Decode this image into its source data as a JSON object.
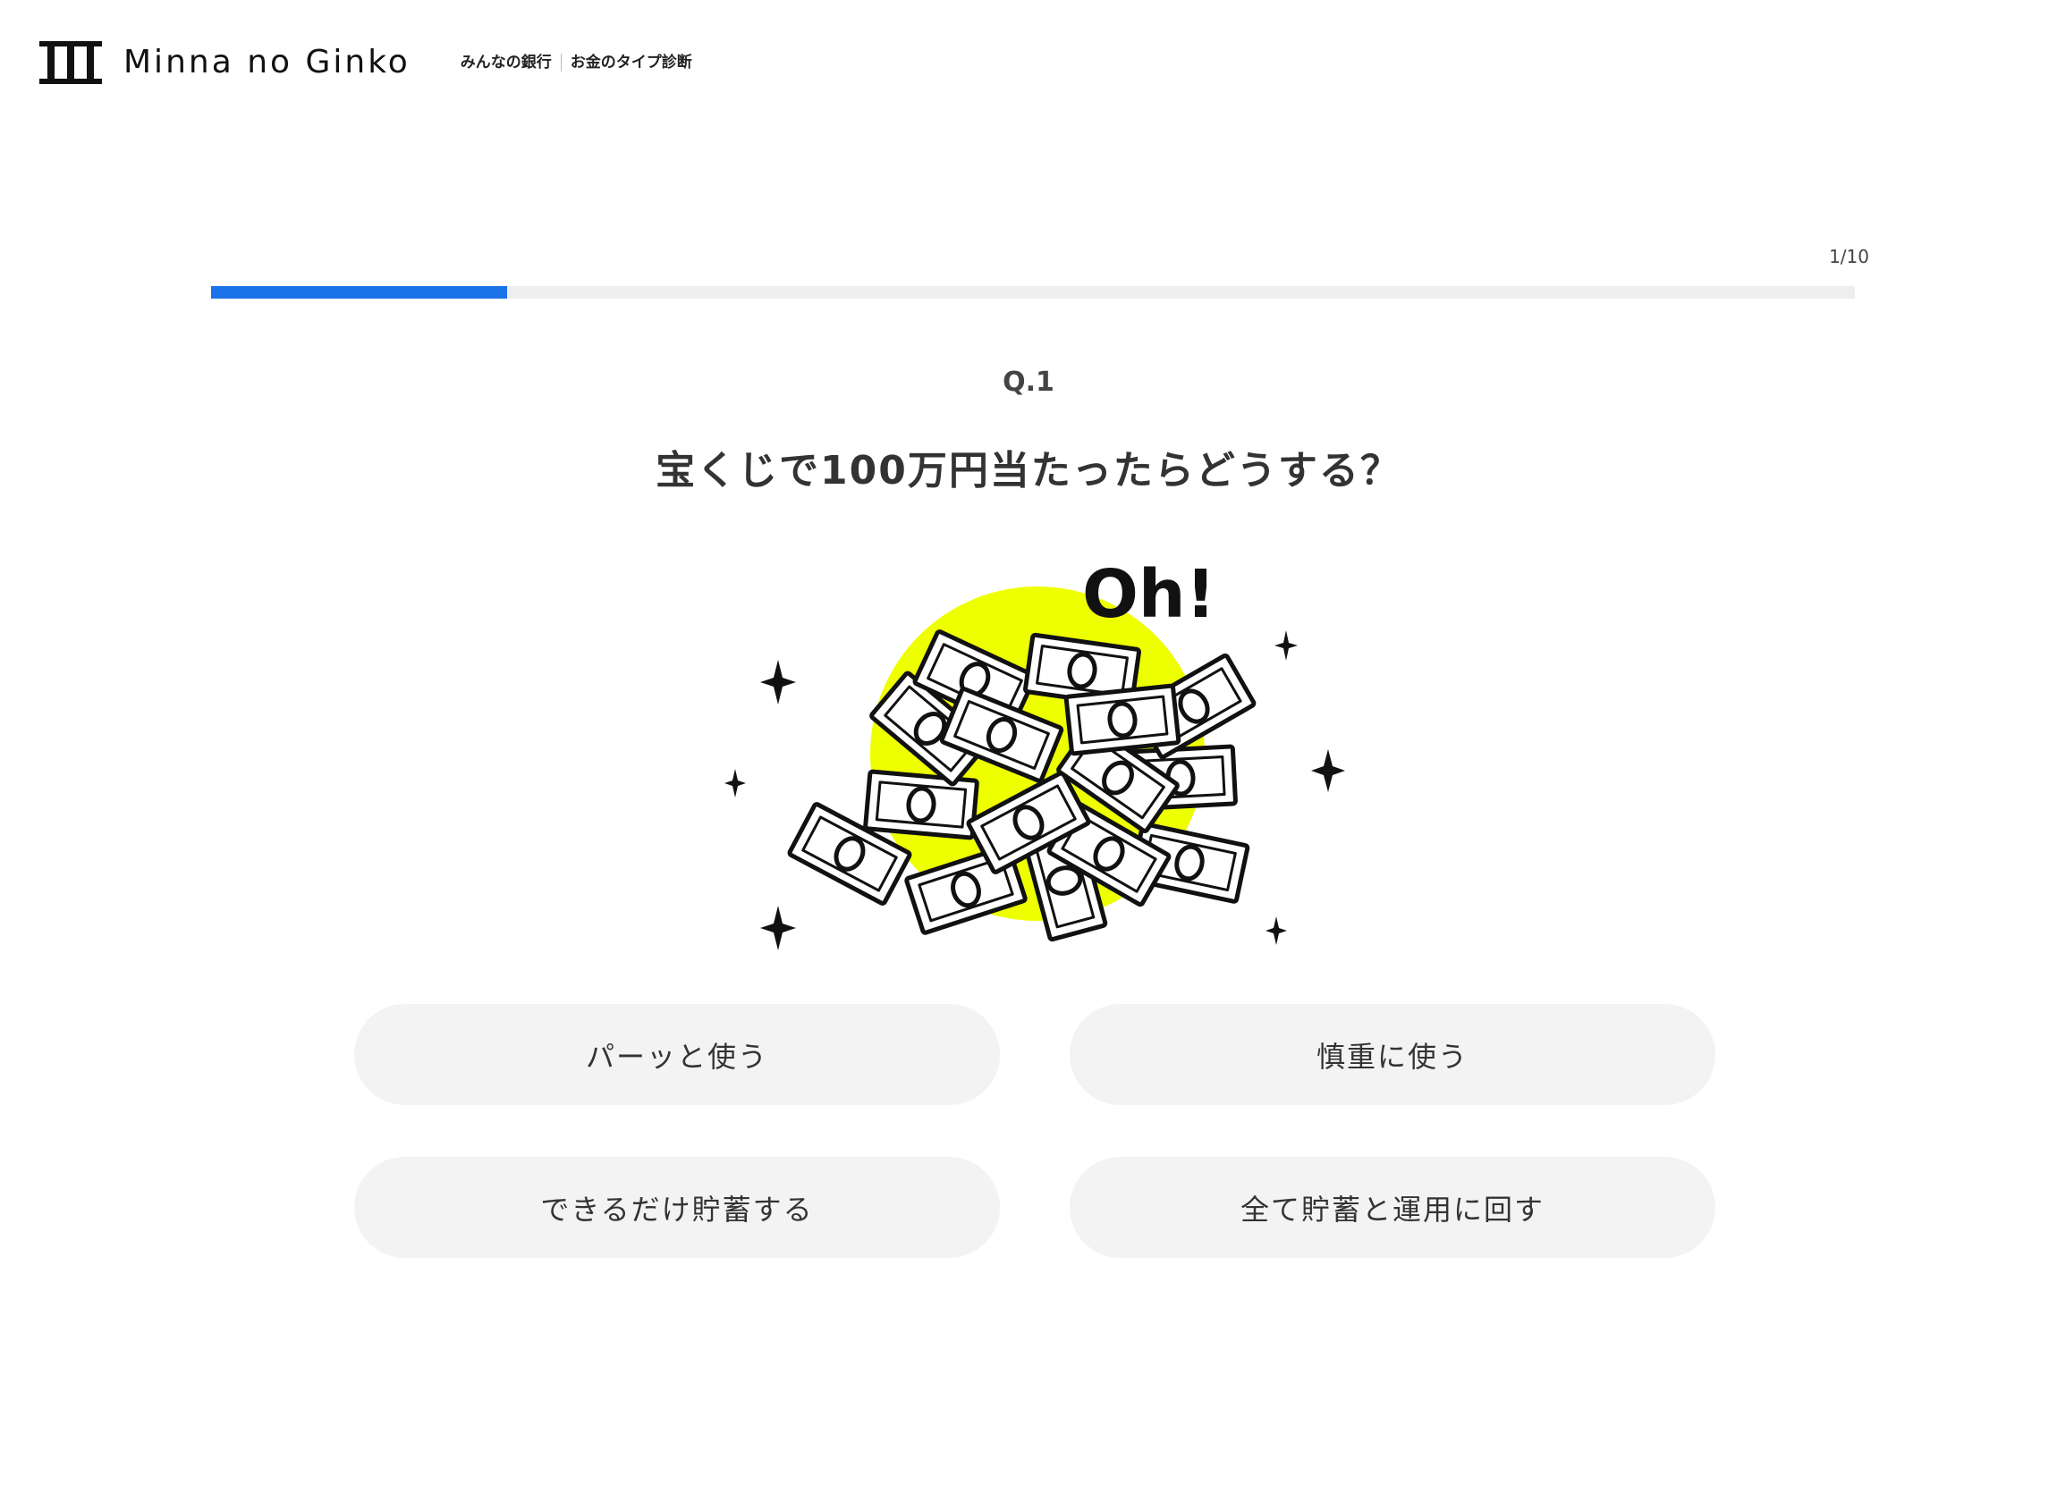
{
  "header": {
    "brand": "Minna no Ginko",
    "bank_name": "みんなの銀行",
    "page_name": "お金のタイプ診断"
  },
  "progress": {
    "label": "1/10",
    "current": 1,
    "total": 10,
    "fill_fraction": 0.18,
    "color": "#1a73e8"
  },
  "question": {
    "number": "Q.1",
    "text": "宝くじで100万円当たったらどうする？",
    "illustration": {
      "caption": "Oh!",
      "icon": "money-pile-illustration",
      "accent_color": "#eeff00"
    }
  },
  "answers": [
    {
      "label": "パーッと使う"
    },
    {
      "label": "慎重に使う"
    },
    {
      "label": "できるだけ貯蓄する"
    },
    {
      "label": "全て貯蓄と運用に回す"
    }
  ]
}
